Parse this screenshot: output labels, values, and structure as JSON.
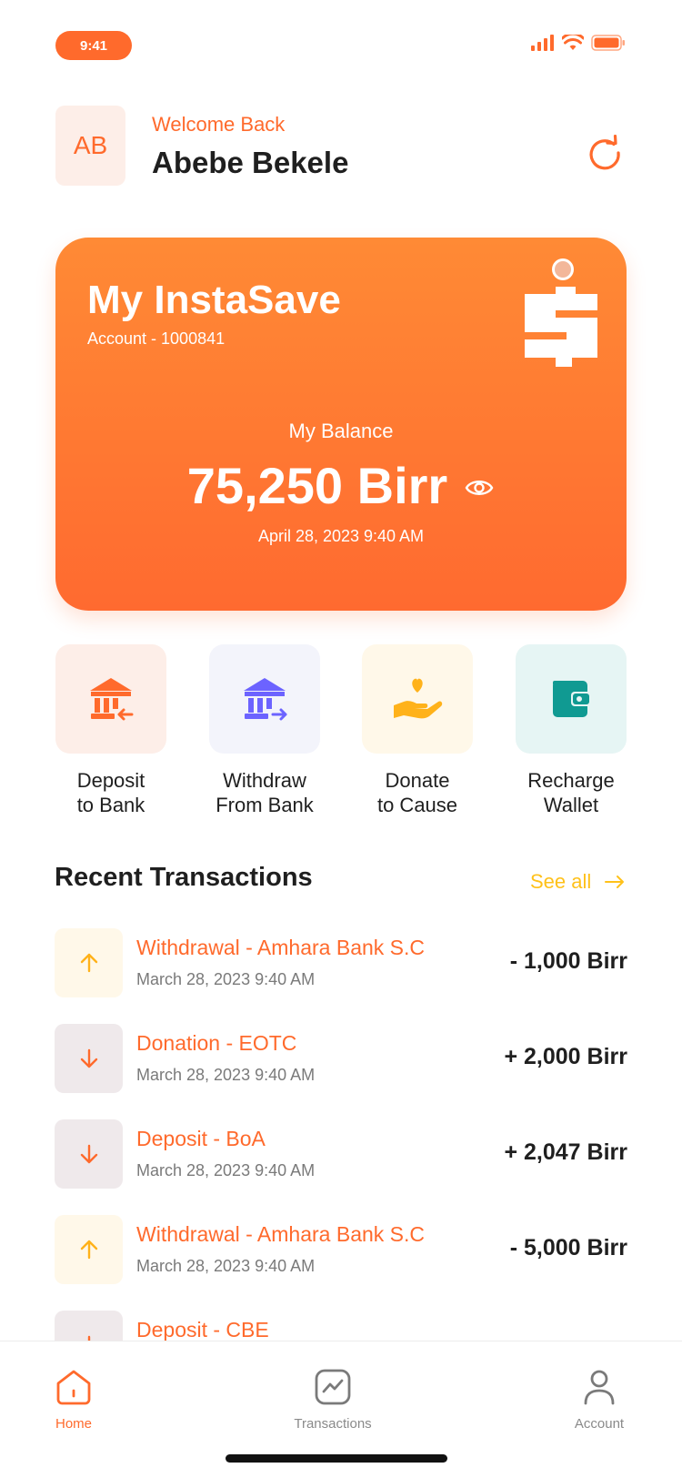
{
  "status_bar": {
    "time": "9:41"
  },
  "header": {
    "avatar_initials": "AB",
    "welcome": "Welcome Back",
    "name": "Abebe Bekele",
    "refresh_icon": "refresh-icon"
  },
  "card": {
    "title": "My InstaSave",
    "account": "Account - 1000841",
    "balance_label": "My Balance",
    "balance": "75,250 Birr",
    "date": "April 28, 2023 9:40 AM",
    "logo_icon": "instasave-logo",
    "eye_icon": "eye-icon"
  },
  "actions": [
    {
      "label": "Deposit\nto Bank",
      "icon": "bank-deposit-icon",
      "bg": "#fdeee8",
      "color": "#ff6a2c"
    },
    {
      "label": "Withdraw\nFrom Bank",
      "icon": "bank-withdraw-icon",
      "bg": "#f3f4fb",
      "color": "#6c63ff"
    },
    {
      "label": "Donate\nto Cause",
      "icon": "donate-hand-heart-icon",
      "bg": "#fff8e9",
      "color": "#ffb21a"
    },
    {
      "label": "Recharge\nWallet",
      "icon": "wallet-icon",
      "bg": "#e6f5f4",
      "color": "#109a92"
    }
  ],
  "recent": {
    "title": "Recent Transactions",
    "see_all": "See all",
    "items": [
      {
        "title": "Withdrawal - Amhara Bank S.C",
        "date": "March 28, 2023 9:40 AM",
        "amount": "- 1,000 Birr",
        "direction": "up"
      },
      {
        "title": "Donation - EOTC",
        "date": "March 28, 2023 9:40 AM",
        "amount": "+ 2,000 Birr",
        "direction": "down"
      },
      {
        "title": "Deposit - BoA",
        "date": "March 28, 2023 9:40 AM",
        "amount": "+ 2,047 Birr",
        "direction": "down"
      },
      {
        "title": "Withdrawal - Amhara Bank S.C",
        "date": "March 28, 2023 9:40 AM",
        "amount": "- 5,000 Birr",
        "direction": "up"
      },
      {
        "title": "Deposit - CBE",
        "date": "",
        "amount": "",
        "direction": "down"
      }
    ]
  },
  "nav": {
    "home": "Home",
    "transactions": "Transactions",
    "account": "Account"
  },
  "colors": {
    "accent": "#ff6a2c",
    "see_all": "#ffc11a"
  }
}
